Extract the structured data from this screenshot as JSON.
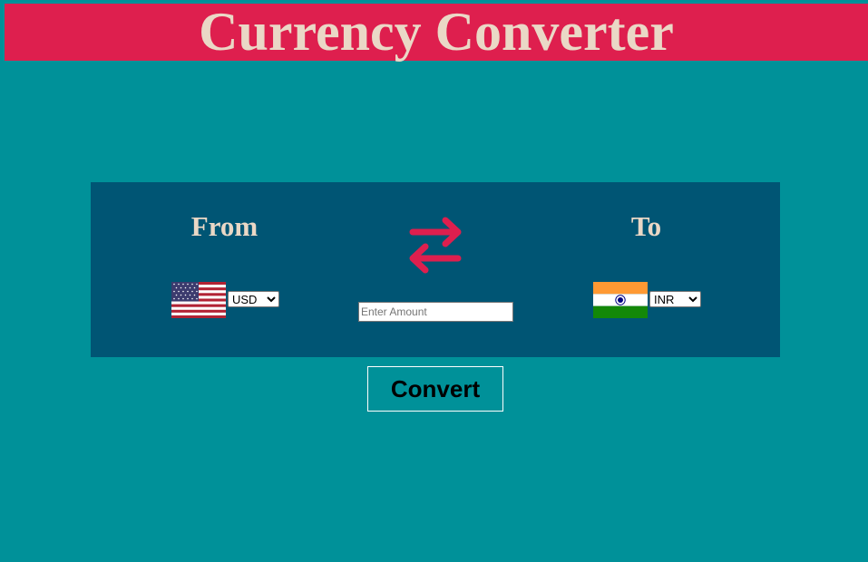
{
  "header": {
    "title": "Currency Converter"
  },
  "converter": {
    "from_label": "From",
    "to_label": "To",
    "from_currency": {
      "selected": "USD",
      "flag": "us-flag-icon"
    },
    "to_currency": {
      "selected": "INR",
      "flag": "india-flag-icon"
    },
    "amount": {
      "value": "",
      "placeholder": "Enter Amount"
    },
    "swap_icon": "swap-arrows-icon",
    "convert_label": "Convert"
  },
  "colors": {
    "background": "#009199",
    "header": "#de1f4e",
    "panel": "#005574",
    "title_text": "#ead8c6",
    "swap_arrows": "#de1f4e"
  }
}
